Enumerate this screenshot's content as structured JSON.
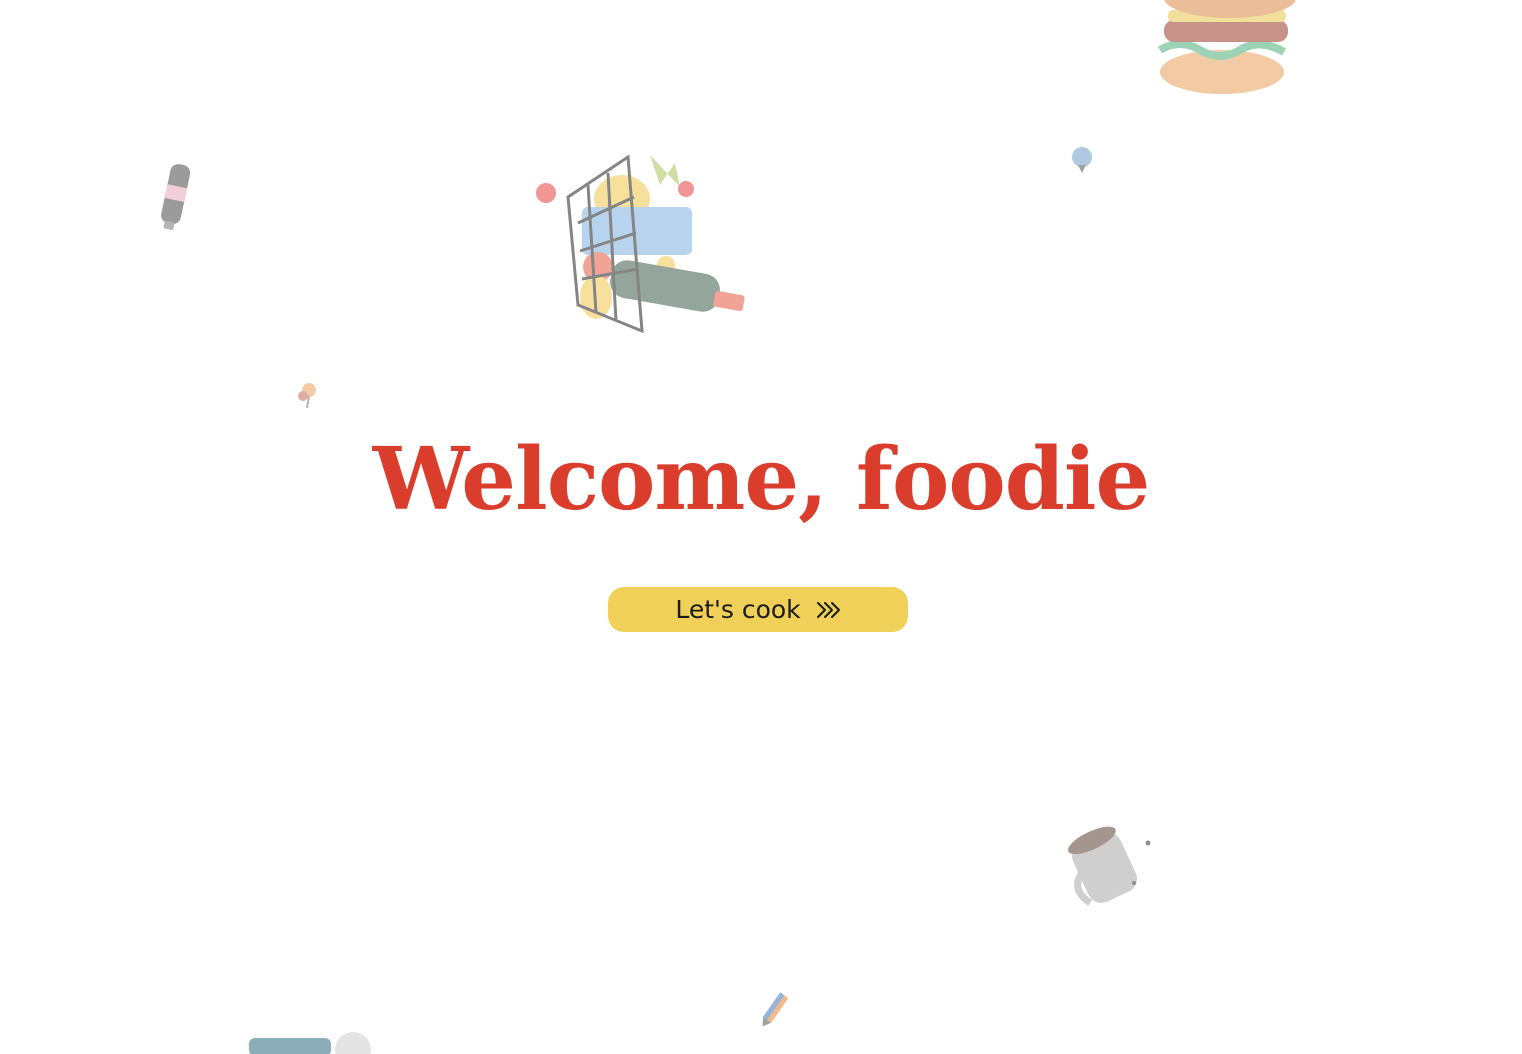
{
  "hero": {
    "title": "Welcome, foodie"
  },
  "cta": {
    "label": "Let's cook",
    "icon": "double-chevron-right-icon"
  },
  "decorations": [
    "burger-icon",
    "bottle-icon",
    "grocery-basket-icon",
    "small-pin-icon",
    "small-flower-icon",
    "coffee-mug-icon",
    "pencil-icon",
    "chef-hat-icon"
  ],
  "colors": {
    "title": "#db3d2c",
    "button": "#f0d058",
    "background": "#ffffff"
  }
}
